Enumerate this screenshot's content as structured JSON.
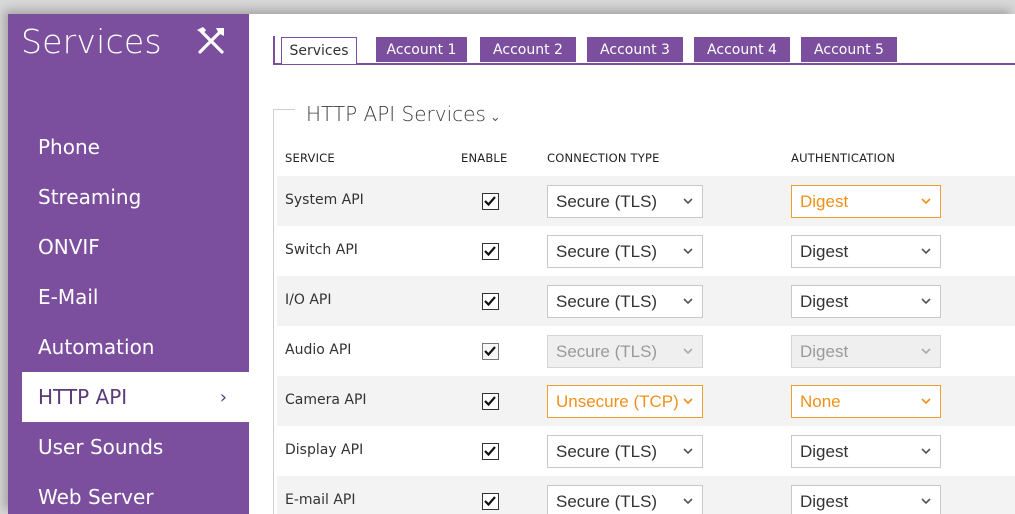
{
  "sidebar": {
    "title": "Services",
    "items": [
      {
        "label": "Phone",
        "active": false
      },
      {
        "label": "Streaming",
        "active": false
      },
      {
        "label": "ONVIF",
        "active": false
      },
      {
        "label": "E-Mail",
        "active": false
      },
      {
        "label": "Automation",
        "active": false
      },
      {
        "label": "HTTP API",
        "active": true
      },
      {
        "label": "User Sounds",
        "active": false
      },
      {
        "label": "Web Server",
        "active": false
      }
    ],
    "active_chevron": "›"
  },
  "tabs": [
    "Services",
    "Account 1",
    "Account 2",
    "Account 3",
    "Account 4",
    "Account 5"
  ],
  "panel": {
    "title": "HTTP API Services",
    "title_chevron": "⌄",
    "columns": {
      "service": "SERVICE",
      "enable": "ENABLE",
      "connection_type": "CONNECTION TYPE",
      "authentication": "AUTHENTICATION"
    }
  },
  "rows": [
    {
      "service": "System API",
      "enabled": true,
      "connection": "Secure (TLS)",
      "auth": "Digest"
    },
    {
      "service": "Switch API",
      "enabled": true,
      "connection": "Secure (TLS)",
      "auth": "Digest"
    },
    {
      "service": "I/O API",
      "enabled": true,
      "connection": "Secure (TLS)",
      "auth": "Digest"
    },
    {
      "service": "Audio API",
      "enabled": true,
      "connection": "Secure (TLS)",
      "auth": "Digest"
    },
    {
      "service": "Camera API",
      "enabled": true,
      "connection": "Unsecure (TCP)",
      "auth": "None"
    },
    {
      "service": "Display API",
      "enabled": true,
      "connection": "Secure (TLS)",
      "auth": "Digest"
    },
    {
      "service": "E-mail API",
      "enabled": true,
      "connection": "Secure (TLS)",
      "auth": "Digest"
    }
  ],
  "colors": {
    "accent": "#7b4f9d",
    "warning": "#f0a030",
    "disabled": "#9a9a9a"
  }
}
